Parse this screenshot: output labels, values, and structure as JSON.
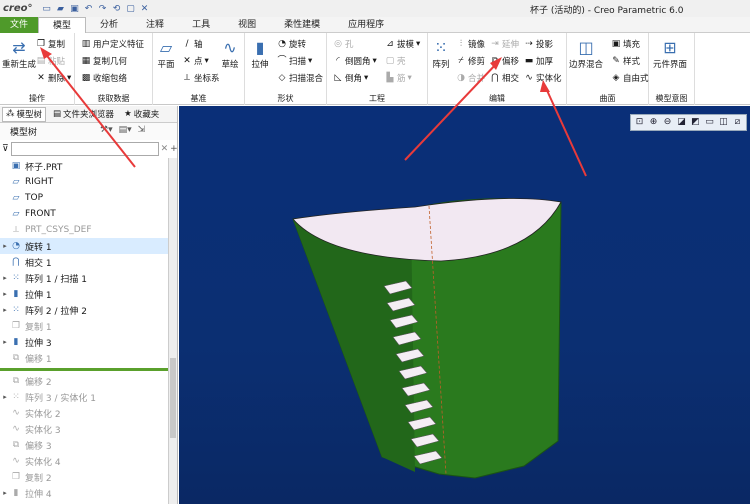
{
  "title_bar": {
    "app_logo": "creo°",
    "window_title": "杯子 (活动的) - Creo Parametric 6.0",
    "quick_access_icons": [
      "new-icon",
      "open-icon",
      "save-icon",
      "undo-icon",
      "redo-icon",
      "regenerate-icon",
      "window-icon",
      "close-window-icon"
    ]
  },
  "menu_tabs": [
    "文件",
    "模型",
    "分析",
    "注释",
    "工具",
    "视图",
    "柔性建模",
    "应用程序"
  ],
  "ribbon": {
    "groups": [
      "操作",
      "获取数据",
      "基准",
      "形状",
      "工程",
      "编辑",
      "曲面",
      "模型意图"
    ],
    "operations": {
      "regenerate": "重新生成",
      "copy": "复制",
      "paste": "粘贴",
      "delete": "删除"
    },
    "get_data": {
      "udf": "用户定义特征",
      "copy_geometry": "复制几何",
      "shrinkwrap": "收缩包络"
    },
    "datum": {
      "plane": "平面",
      "axis": "轴",
      "point": "点",
      "csys": "坐标系",
      "sketch": "草绘"
    },
    "shapes": {
      "extrude": "拉伸",
      "revolve": "旋转",
      "sweep": "扫描",
      "swept_blend": "扫描混合"
    },
    "engineering": {
      "hole": "孔",
      "round": "倒圆角",
      "chamfer": "倒角",
      "draft": "拔模",
      "shell": "壳",
      "rib": "筋"
    },
    "editing": {
      "pattern": "阵列",
      "mirror": "镜像",
      "trim": "修剪",
      "merge": "合并",
      "extend": "延伸",
      "offset": "偏移",
      "intersect": "相交",
      "project": "投影",
      "thicken": "加厚",
      "solidify": "实体化"
    },
    "surfaces": {
      "boundary_blend": "边界混合",
      "fill": "填充",
      "style": "样式",
      "freeform": "自由式"
    },
    "model_intent": {
      "component_interface": "元件界面"
    }
  },
  "panel": {
    "tabs": [
      "模型树",
      "文件夹浏览器",
      "收藏夹"
    ],
    "tree_title": "模型树",
    "search_placeholder": "",
    "items": [
      {
        "label": "杯子.PRT",
        "icon": "part-icon",
        "expand": "",
        "state": "normal"
      },
      {
        "label": "RIGHT",
        "icon": "datum-plane-icon",
        "expand": "",
        "state": "normal"
      },
      {
        "label": "TOP",
        "icon": "datum-plane-icon",
        "expand": "",
        "state": "normal"
      },
      {
        "label": "FRONT",
        "icon": "datum-plane-icon",
        "expand": "",
        "state": "normal"
      },
      {
        "label": "PRT_CSYS_DEF",
        "icon": "csys-icon",
        "expand": "",
        "state": "dim"
      },
      {
        "label": "旋转 1",
        "icon": "revolve-icon",
        "expand": "▸",
        "state": "sel"
      },
      {
        "label": "相交 1",
        "icon": "intersect-icon",
        "expand": "",
        "state": "normal"
      },
      {
        "label": "阵列 1 / 扫描 1",
        "icon": "pattern-icon",
        "expand": "▸",
        "state": "normal"
      },
      {
        "label": "拉伸 1",
        "icon": "extrude-icon",
        "expand": "▸",
        "state": "normal"
      },
      {
        "label": "阵列 2 / 拉伸 2",
        "icon": "pattern-icon",
        "expand": "▸",
        "state": "normal"
      },
      {
        "label": "复制 1",
        "icon": "copy-icon",
        "expand": "",
        "state": "dim"
      },
      {
        "label": "拉伸 3",
        "icon": "extrude-icon",
        "expand": "▸",
        "state": "normal"
      },
      {
        "label": "偏移 1",
        "icon": "offset-icon",
        "expand": "",
        "state": "dim"
      }
    ],
    "items_after": [
      {
        "label": "偏移 2",
        "icon": "offset-icon",
        "expand": "",
        "state": "dim"
      },
      {
        "label": "阵列 3 / 实体化 1",
        "icon": "pattern-icon",
        "expand": "▸",
        "state": "dim"
      },
      {
        "label": "实体化 2",
        "icon": "solidify-icon",
        "expand": "",
        "state": "dim"
      },
      {
        "label": "实体化 3",
        "icon": "solidify-icon",
        "expand": "",
        "state": "dim"
      },
      {
        "label": "偏移 3",
        "icon": "offset-icon",
        "expand": "",
        "state": "dim"
      },
      {
        "label": "实体化 4",
        "icon": "solidify-icon",
        "expand": "",
        "state": "dim"
      },
      {
        "label": "复制 2",
        "icon": "copy-icon",
        "expand": "",
        "state": "dim"
      },
      {
        "label": "拉伸 4",
        "icon": "extrude-icon",
        "expand": "▸",
        "state": "dim"
      }
    ]
  },
  "viewport": {
    "toolbar_icons": [
      "zoom-fit-icon",
      "zoom-in-icon",
      "zoom-out-icon",
      "repaint-icon",
      "display-style-icon",
      "saved-views-icon",
      "view-manager-icon",
      "datum-display-icon"
    ],
    "colors": {
      "background": "#0b2f72",
      "body": "#2a7a1e",
      "top_face": "#f2e8f2",
      "teeth": "#f4eef4",
      "arrow": "#e83a3a"
    }
  }
}
